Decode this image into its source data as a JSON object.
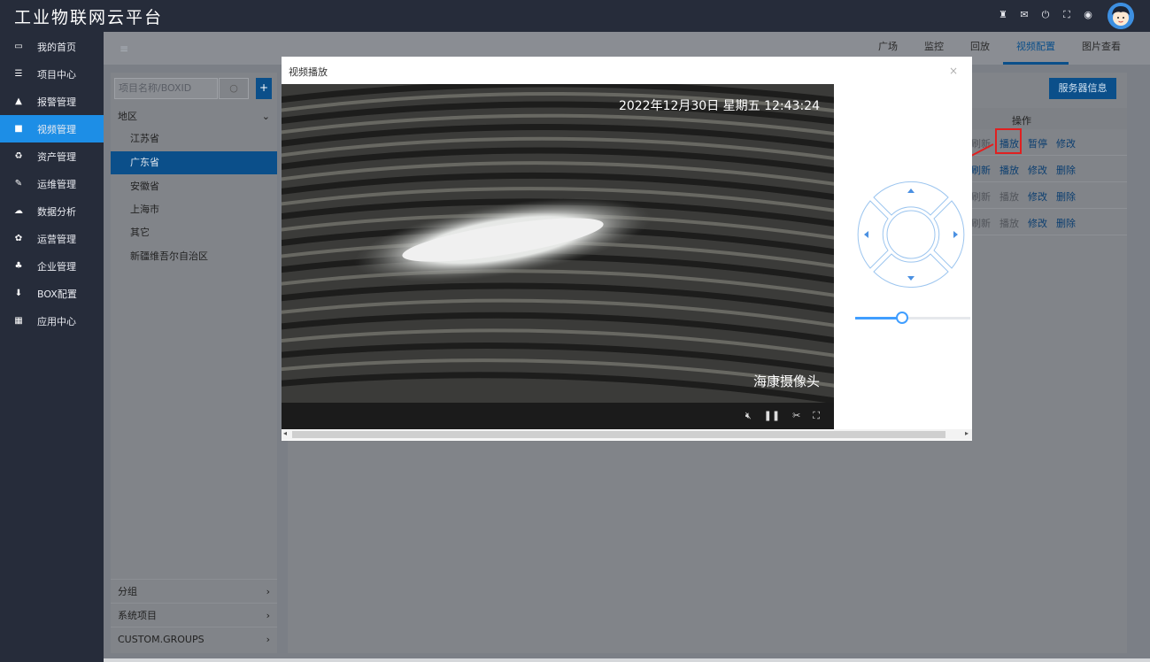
{
  "app": {
    "title": "工业物联网云平台"
  },
  "header_icons": [
    "robot-icon",
    "mail-icon",
    "power-icon",
    "fullscreen-icon",
    "globe-icon"
  ],
  "sidebar": {
    "items": [
      {
        "label": "我的首页",
        "icon": "laptop-icon",
        "active": false
      },
      {
        "label": "项目中心",
        "icon": "list-icon",
        "active": false
      },
      {
        "label": "报警管理",
        "icon": "bell-icon",
        "active": false
      },
      {
        "label": "视频管理",
        "icon": "video-icon",
        "active": true
      },
      {
        "label": "资产管理",
        "icon": "recycle-icon",
        "active": false
      },
      {
        "label": "运维管理",
        "icon": "wrench-icon",
        "active": false
      },
      {
        "label": "数据分析",
        "icon": "cloud-icon",
        "active": false
      },
      {
        "label": "运营管理",
        "icon": "cubes-icon",
        "active": false
      },
      {
        "label": "企业管理",
        "icon": "sitemap-icon",
        "active": false
      },
      {
        "label": "BOX配置",
        "icon": "download-icon",
        "active": false
      },
      {
        "label": "应用中心",
        "icon": "grid-icon",
        "active": false
      }
    ]
  },
  "tabs": [
    {
      "label": "广场",
      "active": false
    },
    {
      "label": "监控",
      "active": false
    },
    {
      "label": "回放",
      "active": false
    },
    {
      "label": "视频配置",
      "active": true
    },
    {
      "label": "图片查看",
      "active": false
    }
  ],
  "tree": {
    "search_placeholder": "项目名称/BOXID",
    "add_label": "+",
    "region_header": "地区",
    "regions": [
      {
        "label": "江苏省",
        "active": false
      },
      {
        "label": "广东省",
        "active": true
      },
      {
        "label": "安徽省",
        "active": false
      },
      {
        "label": "上海市",
        "active": false
      },
      {
        "label": "其它",
        "active": false
      },
      {
        "label": "新疆维吾尔自治区",
        "active": false
      }
    ],
    "groups": [
      "分组",
      "系统项目",
      "CUSTOM.GROUPS"
    ]
  },
  "content": {
    "server_button": "服务器信息",
    "ops_header": "操作",
    "rows": [
      {
        "ops": [
          {
            "label": "刷新",
            "dim": true
          },
          {
            "label": "播放",
            "dim": false
          },
          {
            "label": "暂停",
            "dim": false
          },
          {
            "label": "修改",
            "dim": false
          }
        ]
      },
      {
        "ops": [
          {
            "label": "刷新",
            "dim": false
          },
          {
            "label": "播放",
            "dim": false
          },
          {
            "label": "修改",
            "dim": false
          },
          {
            "label": "删除",
            "dim": false
          }
        ]
      },
      {
        "ops": [
          {
            "label": "刷新",
            "dim": true
          },
          {
            "label": "播放",
            "dim": true
          },
          {
            "label": "修改",
            "dim": false
          },
          {
            "label": "删除",
            "dim": false
          }
        ]
      },
      {
        "ops": [
          {
            "label": "刷新",
            "dim": true
          },
          {
            "label": "播放",
            "dim": true
          },
          {
            "label": "修改",
            "dim": false
          },
          {
            "label": "删除",
            "dim": false
          }
        ]
      }
    ]
  },
  "modal": {
    "title": "视频播放",
    "close": "×",
    "timestamp": "2022年12月30日 星期五 12:43:24",
    "camera_name": "海康摄像头",
    "controls": [
      "mute-icon",
      "pause-icon",
      "scissors-icon",
      "fullscreen-icon"
    ],
    "zoom_level": 0.4
  },
  "colors": {
    "accent": "#1d8ee6",
    "sidebar_bg": "#262c3a",
    "highlight": "#e02020",
    "ptz": "#409eff"
  }
}
